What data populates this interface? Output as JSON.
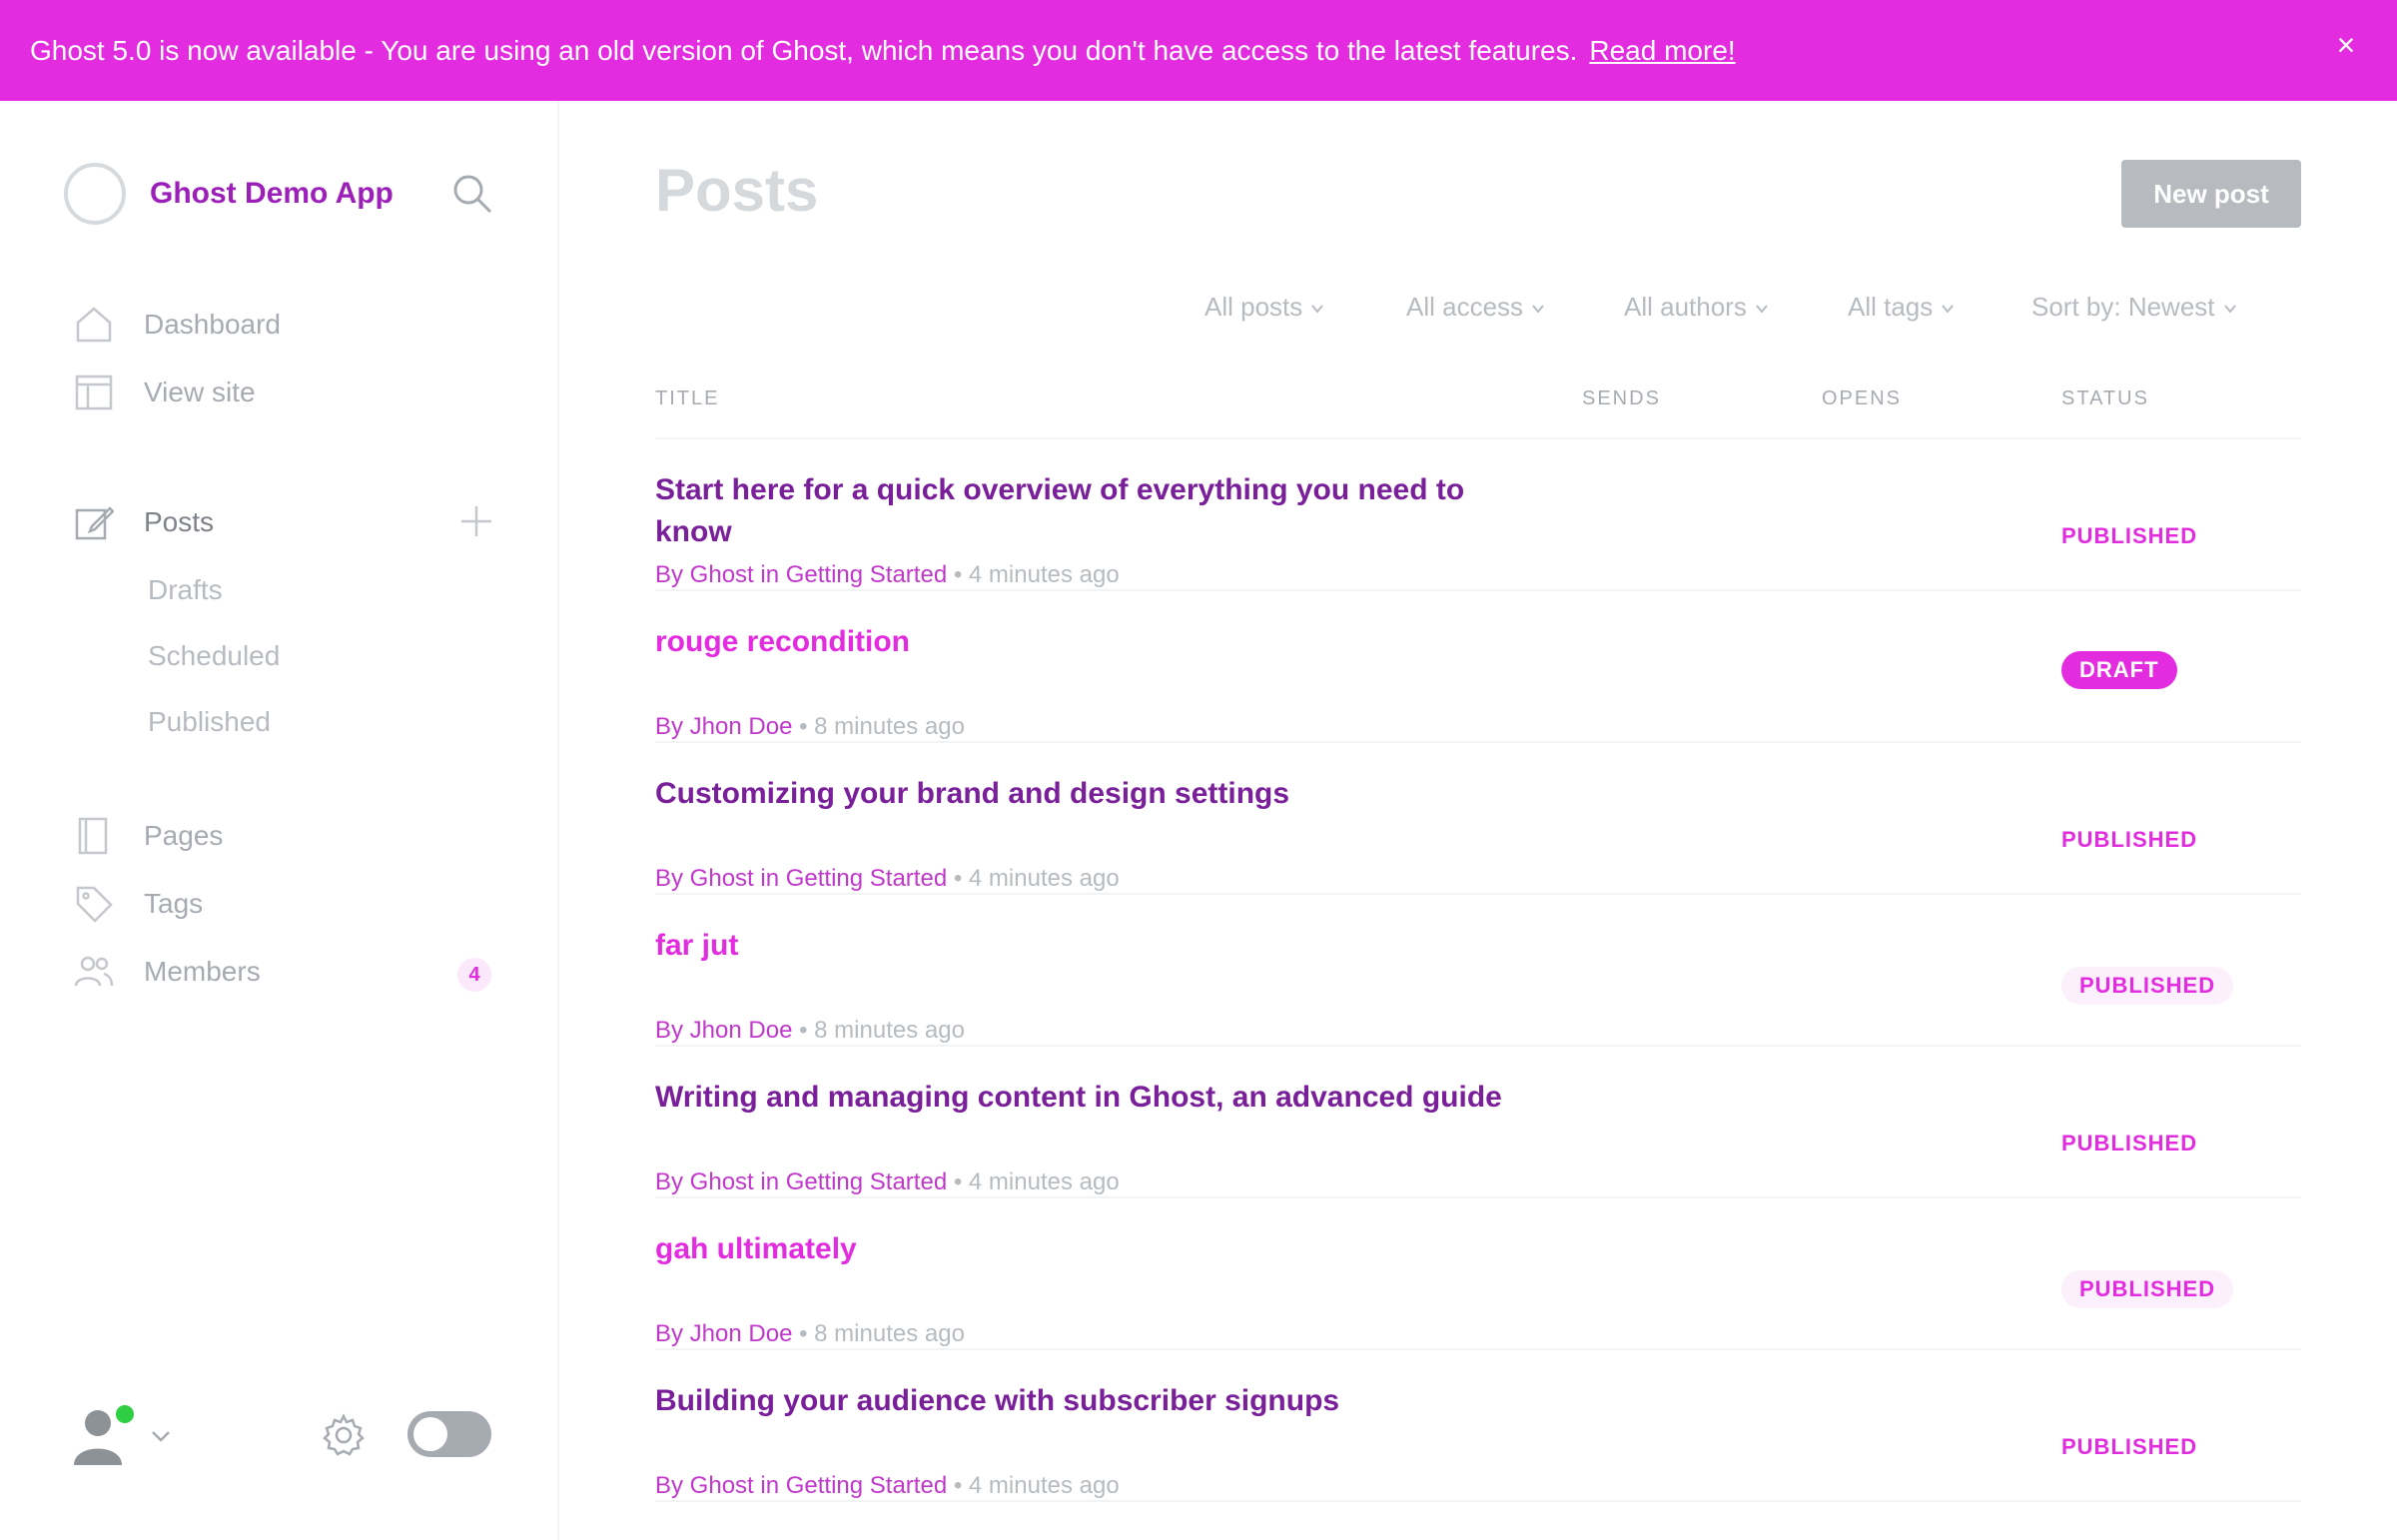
{
  "banner": {
    "text": "Ghost 5.0 is now available - You are using an old version of Ghost, which means you don't have access to the latest features.",
    "link": "Read more!",
    "close": "×"
  },
  "brand": {
    "name": "Ghost Demo App"
  },
  "nav": {
    "dashboard": "Dashboard",
    "view_site": "View site",
    "posts": "Posts",
    "drafts": "Drafts",
    "scheduled": "Scheduled",
    "published": "Published",
    "pages": "Pages",
    "tags": "Tags",
    "members": "Members",
    "members_count": "4"
  },
  "main": {
    "title": "Posts",
    "new_post": "New post",
    "filters": [
      "All posts",
      "All access",
      "All authors",
      "All tags",
      "Sort by: Newest"
    ],
    "columns": {
      "title": "TITLE",
      "sends": "SENDS",
      "opens": "OPENS",
      "status": "STATUS"
    }
  },
  "posts": [
    {
      "title": "Start here for a quick overview of everything you need to know",
      "author": "Ghost",
      "tag": "Getting Started",
      "time": "4 minutes ago",
      "status": "PUBLISHED",
      "style": "plain",
      "color": "dark"
    },
    {
      "title": "rouge recondition",
      "author": "Jhon Doe",
      "tag": "",
      "time": "8 minutes ago",
      "status": "DRAFT",
      "style": "draft",
      "color": "pink"
    },
    {
      "title": "Customizing your brand and design settings",
      "author": "Ghost",
      "tag": "Getting Started",
      "time": "4 minutes ago",
      "status": "PUBLISHED",
      "style": "plain",
      "color": "dark"
    },
    {
      "title": "far jut",
      "author": "Jhon Doe",
      "tag": "",
      "time": "8 minutes ago",
      "status": "PUBLISHED",
      "style": "pill",
      "color": "pink"
    },
    {
      "title": "Writing and managing content in Ghost, an advanced guide",
      "author": "Ghost",
      "tag": "Getting Started",
      "time": "4 minutes ago",
      "status": "PUBLISHED",
      "style": "plain",
      "color": "dark"
    },
    {
      "title": "gah ultimately",
      "author": "Jhon Doe",
      "tag": "",
      "time": "8 minutes ago",
      "status": "PUBLISHED",
      "style": "pill",
      "color": "pink"
    },
    {
      "title": "Building your audience with subscriber signups",
      "author": "Ghost",
      "tag": "Getting Started",
      "time": "4 minutes ago",
      "status": "PUBLISHED",
      "style": "plain",
      "color": "dark"
    }
  ],
  "colors": {
    "accent": "#e32ce0",
    "brand_text": "#9b1fb8",
    "online": "#30cf43"
  }
}
